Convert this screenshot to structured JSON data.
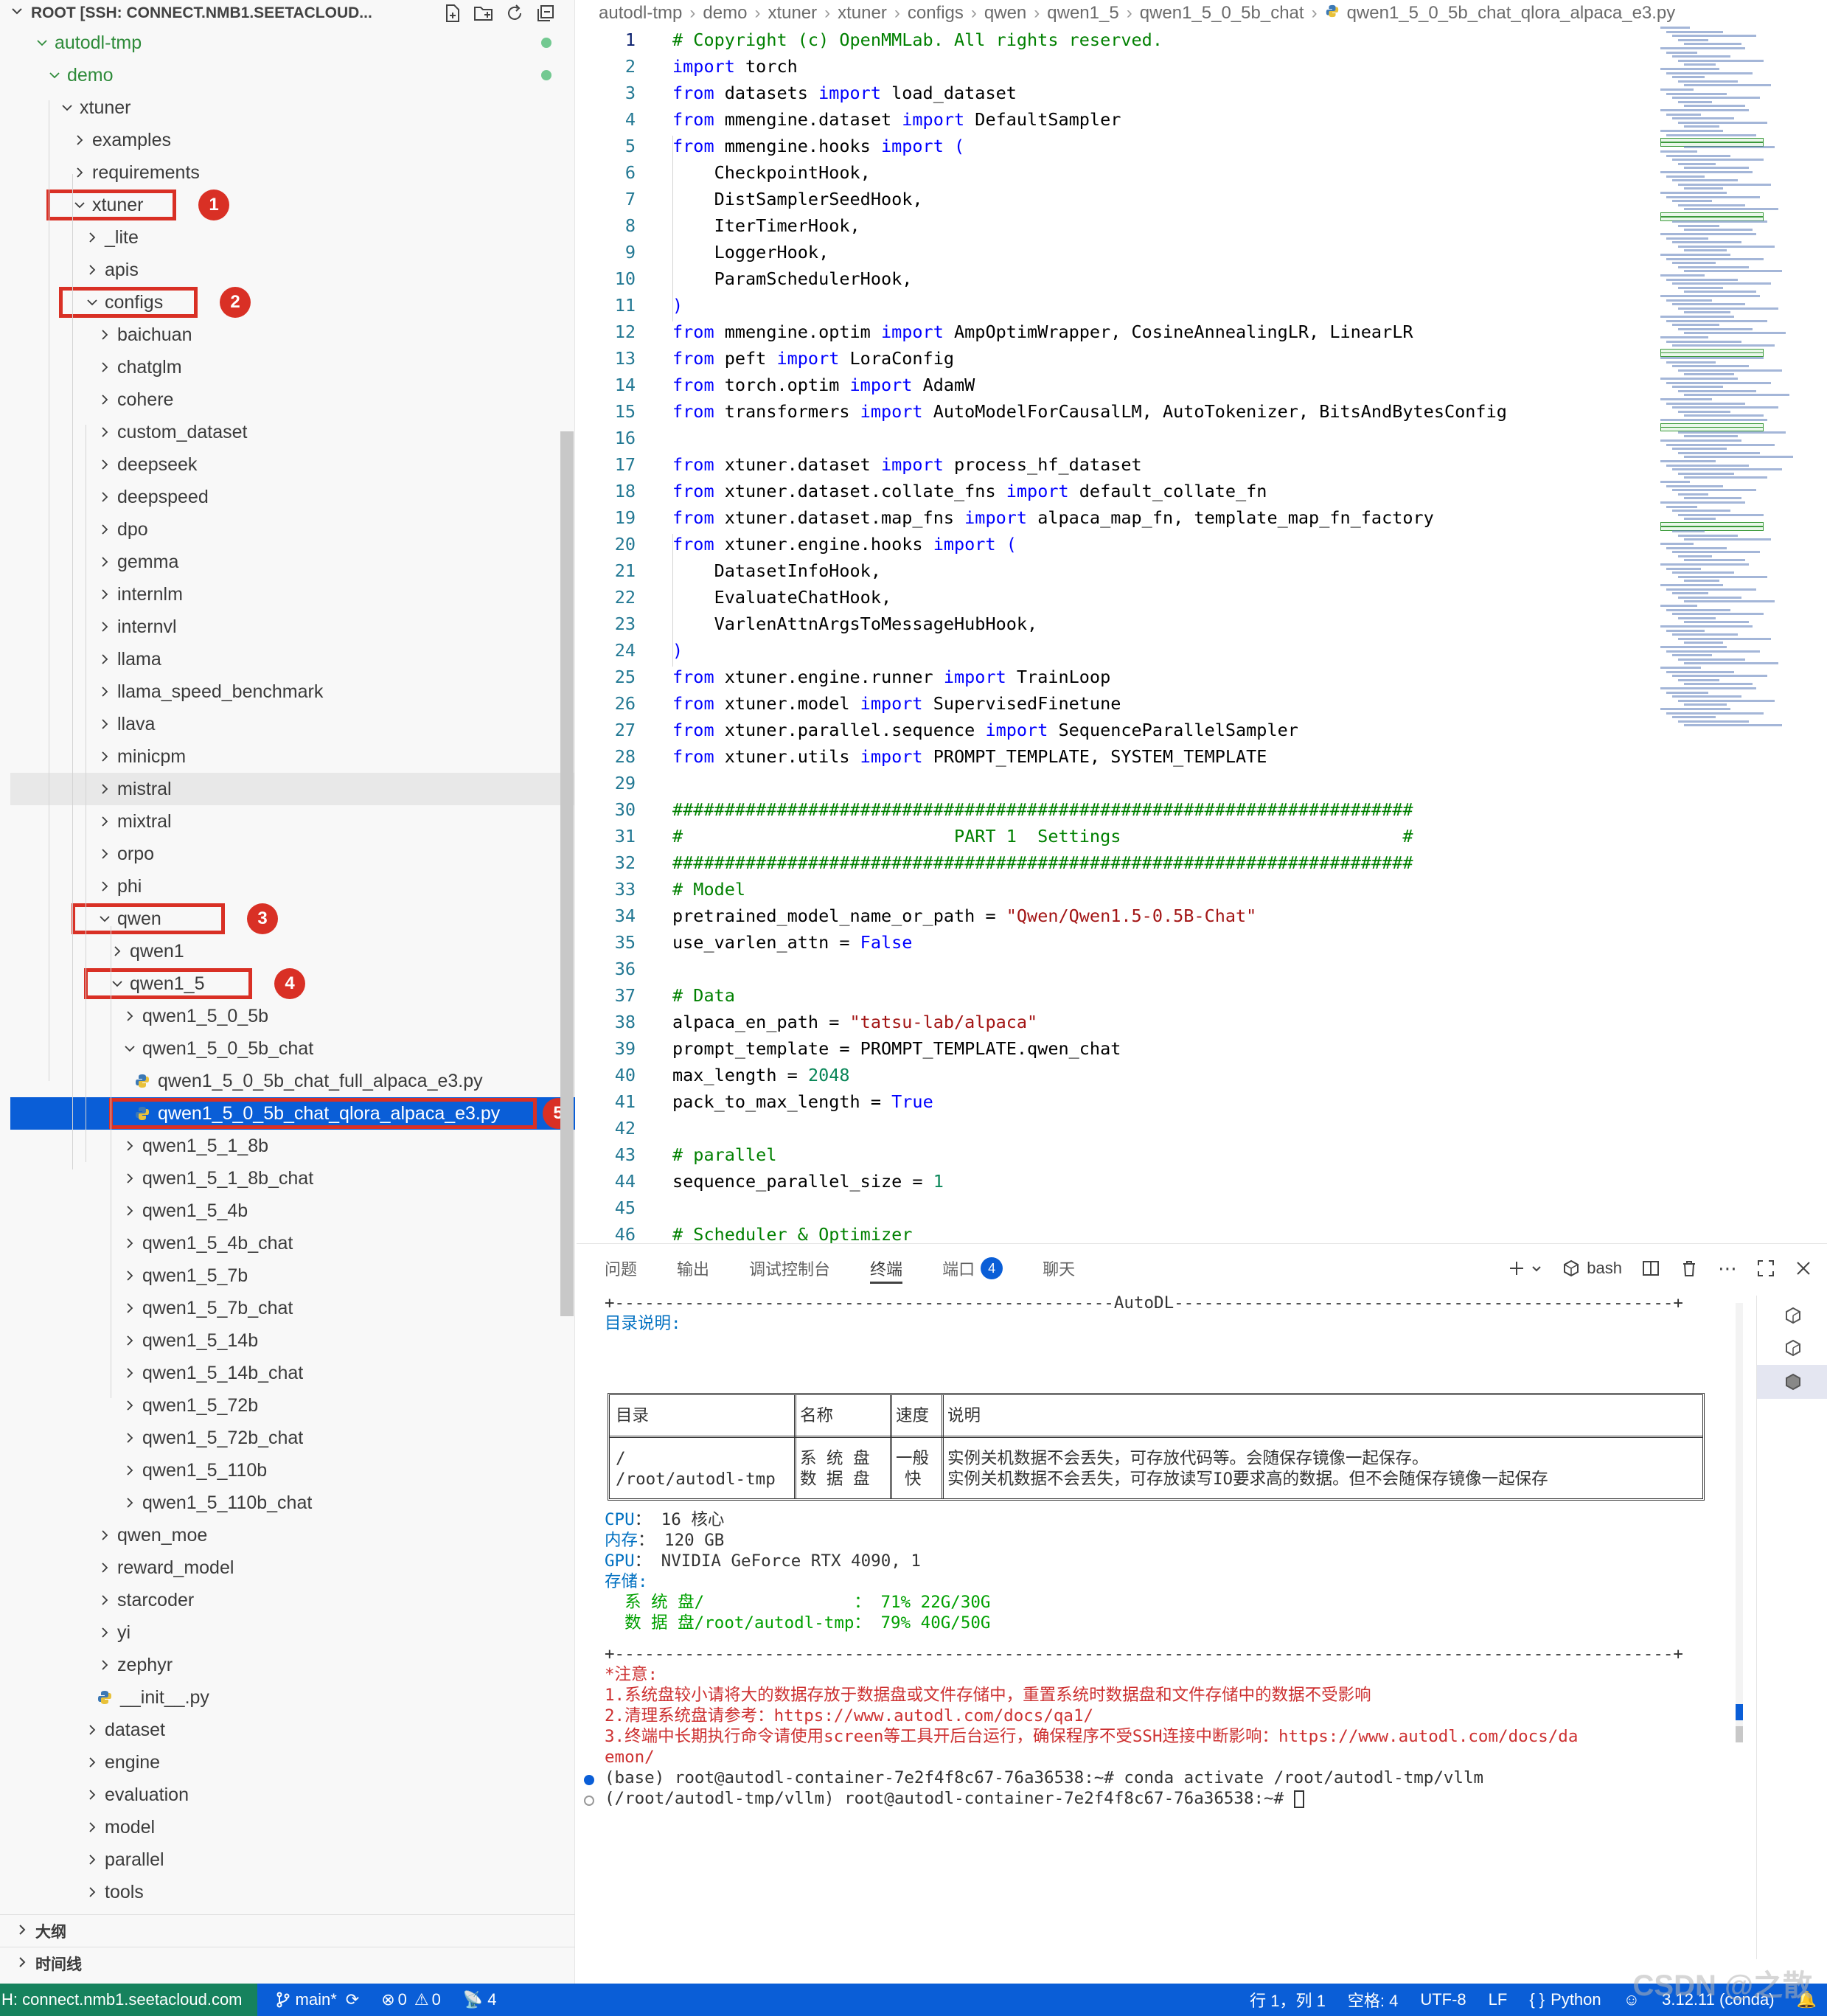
{
  "explorer": {
    "title": "ROOT [SSH: CONNECT.NMB1.SEETACLOUD...",
    "tree": [
      {
        "label": "autodl-tmp",
        "depth": 0,
        "type": "folder",
        "open": true,
        "green": true,
        "dot": true
      },
      {
        "label": "demo",
        "depth": 1,
        "type": "folder",
        "open": true,
        "green": true,
        "dot": true
      },
      {
        "label": "xtuner",
        "depth": 2,
        "type": "folder",
        "open": true
      },
      {
        "label": "examples",
        "depth": 3,
        "type": "folder",
        "open": false
      },
      {
        "label": "requirements",
        "depth": 3,
        "type": "folder",
        "open": false
      },
      {
        "label": "xtuner",
        "depth": 3,
        "type": "folder",
        "open": true,
        "box": 1
      },
      {
        "label": "_lite",
        "depth": 4,
        "type": "folder",
        "open": false
      },
      {
        "label": "apis",
        "depth": 4,
        "type": "folder",
        "open": false
      },
      {
        "label": "configs",
        "depth": 4,
        "type": "folder",
        "open": true,
        "box": 2
      },
      {
        "label": "baichuan",
        "depth": 5,
        "type": "folder",
        "open": false
      },
      {
        "label": "chatglm",
        "depth": 5,
        "type": "folder",
        "open": false
      },
      {
        "label": "cohere",
        "depth": 5,
        "type": "folder",
        "open": false
      },
      {
        "label": "custom_dataset",
        "depth": 5,
        "type": "folder",
        "open": false
      },
      {
        "label": "deepseek",
        "depth": 5,
        "type": "folder",
        "open": false
      },
      {
        "label": "deepspeed",
        "depth": 5,
        "type": "folder",
        "open": false
      },
      {
        "label": "dpo",
        "depth": 5,
        "type": "folder",
        "open": false
      },
      {
        "label": "gemma",
        "depth": 5,
        "type": "folder",
        "open": false
      },
      {
        "label": "internlm",
        "depth": 5,
        "type": "folder",
        "open": false
      },
      {
        "label": "internvl",
        "depth": 5,
        "type": "folder",
        "open": false
      },
      {
        "label": "llama",
        "depth": 5,
        "type": "folder",
        "open": false
      },
      {
        "label": "llama_speed_benchmark",
        "depth": 5,
        "type": "folder",
        "open": false
      },
      {
        "label": "llava",
        "depth": 5,
        "type": "folder",
        "open": false
      },
      {
        "label": "minicpm",
        "depth": 5,
        "type": "folder",
        "open": false
      },
      {
        "label": "mistral",
        "depth": 5,
        "type": "folder",
        "open": false,
        "hover": true
      },
      {
        "label": "mixtral",
        "depth": 5,
        "type": "folder",
        "open": false
      },
      {
        "label": "orpo",
        "depth": 5,
        "type": "folder",
        "open": false
      },
      {
        "label": "phi",
        "depth": 5,
        "type": "folder",
        "open": false
      },
      {
        "label": "qwen",
        "depth": 5,
        "type": "folder",
        "open": true,
        "box": 3
      },
      {
        "label": "qwen1",
        "depth": 6,
        "type": "folder",
        "open": false
      },
      {
        "label": "qwen1_5",
        "depth": 6,
        "type": "folder",
        "open": true,
        "box": 4
      },
      {
        "label": "qwen1_5_0_5b",
        "depth": 7,
        "type": "folder",
        "open": false
      },
      {
        "label": "qwen1_5_0_5b_chat",
        "depth": 7,
        "type": "folder",
        "open": true
      },
      {
        "label": "qwen1_5_0_5b_chat_full_alpaca_e3.py",
        "depth": 8,
        "type": "py"
      },
      {
        "label": "qwen1_5_0_5b_chat_qlora_alpaca_e3.py",
        "depth": 8,
        "type": "py",
        "selected": true,
        "box": 5
      },
      {
        "label": "qwen1_5_1_8b",
        "depth": 7,
        "type": "folder",
        "open": false
      },
      {
        "label": "qwen1_5_1_8b_chat",
        "depth": 7,
        "type": "folder",
        "open": false
      },
      {
        "label": "qwen1_5_4b",
        "depth": 7,
        "type": "folder",
        "open": false
      },
      {
        "label": "qwen1_5_4b_chat",
        "depth": 7,
        "type": "folder",
        "open": false
      },
      {
        "label": "qwen1_5_7b",
        "depth": 7,
        "type": "folder",
        "open": false
      },
      {
        "label": "qwen1_5_7b_chat",
        "depth": 7,
        "type": "folder",
        "open": false
      },
      {
        "label": "qwen1_5_14b",
        "depth": 7,
        "type": "folder",
        "open": false
      },
      {
        "label": "qwen1_5_14b_chat",
        "depth": 7,
        "type": "folder",
        "open": false
      },
      {
        "label": "qwen1_5_72b",
        "depth": 7,
        "type": "folder",
        "open": false
      },
      {
        "label": "qwen1_5_72b_chat",
        "depth": 7,
        "type": "folder",
        "open": false
      },
      {
        "label": "qwen1_5_110b",
        "depth": 7,
        "type": "folder",
        "open": false
      },
      {
        "label": "qwen1_5_110b_chat",
        "depth": 7,
        "type": "folder",
        "open": false
      },
      {
        "label": "qwen_moe",
        "depth": 5,
        "type": "folder",
        "open": false
      },
      {
        "label": "reward_model",
        "depth": 5,
        "type": "folder",
        "open": false
      },
      {
        "label": "starcoder",
        "depth": 5,
        "type": "folder",
        "open": false
      },
      {
        "label": "yi",
        "depth": 5,
        "type": "folder",
        "open": false
      },
      {
        "label": "zephyr",
        "depth": 5,
        "type": "folder",
        "open": false
      },
      {
        "label": "__init__.py",
        "depth": 5,
        "type": "py"
      },
      {
        "label": "dataset",
        "depth": 4,
        "type": "folder",
        "open": false
      },
      {
        "label": "engine",
        "depth": 4,
        "type": "folder",
        "open": false
      },
      {
        "label": "evaluation",
        "depth": 4,
        "type": "folder",
        "open": false
      },
      {
        "label": "model",
        "depth": 4,
        "type": "folder",
        "open": false
      },
      {
        "label": "parallel",
        "depth": 4,
        "type": "folder",
        "open": false
      },
      {
        "label": "tools",
        "depth": 4,
        "type": "folder",
        "open": false
      }
    ],
    "badges": [
      "1",
      "2",
      "3",
      "4",
      "5"
    ],
    "sections": [
      "大纲",
      "时间线"
    ]
  },
  "breadcrumb": [
    "autodl-tmp",
    "demo",
    "xtuner",
    "xtuner",
    "configs",
    "qwen",
    "qwen1_5",
    "qwen1_5_0_5b_chat",
    "qwen1_5_0_5b_chat_qlora_alpaca_e3.py"
  ],
  "editor": {
    "current_line": 1,
    "lines": [
      [
        [
          "cm",
          "# Copyright (c) OpenMMLab. All rights reserved."
        ]
      ],
      [
        [
          "kw",
          "import"
        ],
        [
          "id",
          " torch"
        ]
      ],
      [
        [
          "kw",
          "from"
        ],
        [
          "id",
          " datasets "
        ],
        [
          "kw",
          "import"
        ],
        [
          "id",
          " load_dataset"
        ]
      ],
      [
        [
          "kw",
          "from"
        ],
        [
          "id",
          " mmengine.dataset "
        ],
        [
          "kw",
          "import"
        ],
        [
          "id",
          " DefaultSampler"
        ]
      ],
      [
        [
          "kw",
          "from"
        ],
        [
          "id",
          " mmengine.hooks "
        ],
        [
          "kw",
          "import"
        ],
        [
          "cs",
          " ("
        ]
      ],
      [
        [
          "id",
          "    CheckpointHook,"
        ]
      ],
      [
        [
          "id",
          "    DistSamplerSeedHook,"
        ]
      ],
      [
        [
          "id",
          "    IterTimerHook,"
        ]
      ],
      [
        [
          "id",
          "    LoggerHook,"
        ]
      ],
      [
        [
          "id",
          "    ParamSchedulerHook,"
        ]
      ],
      [
        [
          "cs",
          ")"
        ]
      ],
      [
        [
          "kw",
          "from"
        ],
        [
          "id",
          " mmengine.optim "
        ],
        [
          "kw",
          "import"
        ],
        [
          "id",
          " AmpOptimWrapper, CosineAnnealingLR, LinearLR"
        ]
      ],
      [
        [
          "kw",
          "from"
        ],
        [
          "id",
          " peft "
        ],
        [
          "kw",
          "import"
        ],
        [
          "id",
          " LoraConfig"
        ]
      ],
      [
        [
          "kw",
          "from"
        ],
        [
          "id",
          " torch.optim "
        ],
        [
          "kw",
          "import"
        ],
        [
          "id",
          " AdamW"
        ]
      ],
      [
        [
          "kw",
          "from"
        ],
        [
          "id",
          " transformers "
        ],
        [
          "kw",
          "import"
        ],
        [
          "id",
          " AutoModelForCausalLM, AutoTokenizer, BitsAndBytesConfig"
        ]
      ],
      [],
      [
        [
          "kw",
          "from"
        ],
        [
          "id",
          " xtuner.dataset "
        ],
        [
          "kw",
          "import"
        ],
        [
          "id",
          " process_hf_dataset"
        ]
      ],
      [
        [
          "kw",
          "from"
        ],
        [
          "id",
          " xtuner.dataset.collate_fns "
        ],
        [
          "kw",
          "import"
        ],
        [
          "id",
          " default_collate_fn"
        ]
      ],
      [
        [
          "kw",
          "from"
        ],
        [
          "id",
          " xtuner.dataset.map_fns "
        ],
        [
          "kw",
          "import"
        ],
        [
          "id",
          " alpaca_map_fn, template_map_fn_factory"
        ]
      ],
      [
        [
          "kw",
          "from"
        ],
        [
          "id",
          " xtuner.engine.hooks "
        ],
        [
          "kw",
          "import"
        ],
        [
          "cs",
          " ("
        ]
      ],
      [
        [
          "id",
          "    DatasetInfoHook,"
        ]
      ],
      [
        [
          "id",
          "    EvaluateChatHook,"
        ]
      ],
      [
        [
          "id",
          "    VarlenAttnArgsToMessageHubHook,"
        ]
      ],
      [
        [
          "cs",
          ")"
        ]
      ],
      [
        [
          "kw",
          "from"
        ],
        [
          "id",
          " xtuner.engine.runner "
        ],
        [
          "kw",
          "import"
        ],
        [
          "id",
          " TrainLoop"
        ]
      ],
      [
        [
          "kw",
          "from"
        ],
        [
          "id",
          " xtuner.model "
        ],
        [
          "kw",
          "import"
        ],
        [
          "id",
          " SupervisedFinetune"
        ]
      ],
      [
        [
          "kw",
          "from"
        ],
        [
          "id",
          " xtuner.parallel.sequence "
        ],
        [
          "kw",
          "import"
        ],
        [
          "id",
          " SequenceParallelSampler"
        ]
      ],
      [
        [
          "kw",
          "from"
        ],
        [
          "id",
          " xtuner.utils "
        ],
        [
          "kw",
          "import"
        ],
        [
          "id",
          " PROMPT_TEMPLATE, SYSTEM_TEMPLATE"
        ]
      ],
      [],
      [
        [
          "cm",
          "#######################################################################"
        ]
      ],
      [
        [
          "cm",
          "#                          PART 1  Settings                           #"
        ]
      ],
      [
        [
          "cm",
          "#######################################################################"
        ]
      ],
      [
        [
          "cm",
          "# Model"
        ]
      ],
      [
        [
          "id",
          "pretrained_model_name_or_path = "
        ],
        [
          "st",
          "\"Qwen/Qwen1.5-0.5B-Chat\""
        ]
      ],
      [
        [
          "id",
          "use_varlen_attn = "
        ],
        [
          "kw",
          "False"
        ]
      ],
      [],
      [
        [
          "cm",
          "# Data"
        ]
      ],
      [
        [
          "id",
          "alpaca_en_path = "
        ],
        [
          "st",
          "\"tatsu-lab/alpaca\""
        ]
      ],
      [
        [
          "id",
          "prompt_template = PROMPT_TEMPLATE.qwen_chat"
        ]
      ],
      [
        [
          "id",
          "max_length = "
        ],
        [
          "nm",
          "2048"
        ]
      ],
      [
        [
          "id",
          "pack_to_max_length = "
        ],
        [
          "kw",
          "True"
        ]
      ],
      [],
      [
        [
          "cm",
          "# parallel"
        ]
      ],
      [
        [
          "id",
          "sequence_parallel_size = "
        ],
        [
          "nm",
          "1"
        ]
      ],
      [],
      [
        [
          "cm",
          "# Scheduler & Optimizer"
        ]
      ]
    ]
  },
  "panel": {
    "tabs": [
      "问题",
      "输出",
      "调试控制台",
      "终端",
      "端口",
      "聊天"
    ],
    "active_tab": "终端",
    "ports_count": "4",
    "shell": "bash"
  },
  "terminal": {
    "banner": "+--------------------------------------------------AutoDL--------------------------------------------------+",
    "dir_title": "目录说明:",
    "table_headers": [
      "目录",
      "名称",
      "速度",
      "说明"
    ],
    "table_dirs": [
      "/",
      "/root/autodl-tmp"
    ],
    "table_names": [
      "系 统 盘",
      "数 据 盘"
    ],
    "table_speed": [
      "一般",
      "快"
    ],
    "table_desc": [
      "实例关机数据不会丢失，可存放代码等。会随保存镜像一起保存。",
      "实例关机数据不会丢失，可存放读写IO要求高的数据。但不会随保存镜像一起保存"
    ],
    "cpu_label": "CPU",
    "cpu_value": "： 16 核心",
    "mem_label": "内存",
    "mem_value": "： 120 GB",
    "gpu_label": "GPU",
    "gpu_value": "： NVIDIA GeForce RTX 4090, 1",
    "storage_label": "存储:",
    "sys_disk": "  系 统 盘/               ： 71% 22G/30G",
    "data_disk": "  数 据 盘/root/autodl-tmp： 79% 40G/50G",
    "divider": "+----------------------------------------------------------------------------------------------------------+",
    "notice_title": "*注意:",
    "notice1": "1.系统盘较小请将大的数据存放于数据盘或文件存储中，重置系统时数据盘和文件存储中的数据不受影响",
    "notice2": "2.清理系统盘请参考：https://www.autodl.com/docs/qa1/",
    "notice3a": "3.终端中长期执行命令请使用screen等工具开后台运行，确保程序不受SSH连接中断影响：https://www.autodl.com/docs/da",
    "notice3b": "emon/",
    "cmd1": "(base) root@autodl-container-7e2f4f8c67-76a36538:~# conda activate /root/autodl-tmp/vllm",
    "cmd2": "(/root/autodl-tmp/vllm) root@autodl-container-7e2f4f8c67-76a36538:~# "
  },
  "statusbar": {
    "remote": "H: connect.nmb1.seetacloud.com",
    "branch": "main*",
    "errors": "0",
    "warnings": "0",
    "ports": "4",
    "position": "行 1，列 1",
    "spaces": "空格: 4",
    "encoding": "UTF-8",
    "eol": "LF",
    "language": "Python",
    "python_version": "3.12.11 (conda)"
  },
  "watermark": "CSDN @之散",
  "colors": {
    "accent": "#0a5ed7",
    "remote": "#16825d",
    "annotation": "#d93025",
    "keyword": "#0000ff",
    "comment": "#008000",
    "string": "#a31515"
  }
}
